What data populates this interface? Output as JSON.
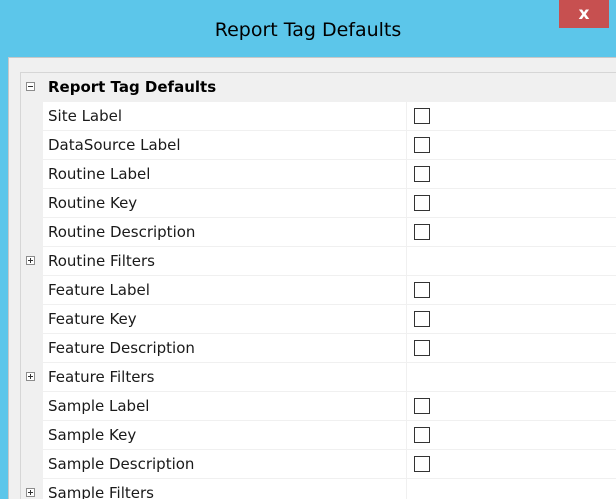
{
  "window": {
    "title": "Report Tag Defaults",
    "close_label": "x"
  },
  "grid": {
    "category": {
      "label": "Report Tag Defaults",
      "expanded": true,
      "expander_glyph": "minus"
    },
    "rows": [
      {
        "label": "Site Label",
        "kind": "checkbox",
        "checked": false
      },
      {
        "label": "DataSource Label",
        "kind": "checkbox",
        "checked": false
      },
      {
        "label": "Routine Label",
        "kind": "checkbox",
        "checked": false
      },
      {
        "label": "Routine Key",
        "kind": "checkbox",
        "checked": false
      },
      {
        "label": "Routine Description",
        "kind": "checkbox",
        "checked": false
      },
      {
        "label": "Routine Filters",
        "kind": "group",
        "expanded": false
      },
      {
        "label": "Feature Label",
        "kind": "checkbox",
        "checked": false
      },
      {
        "label": "Feature Key",
        "kind": "checkbox",
        "checked": false
      },
      {
        "label": "Feature Description",
        "kind": "checkbox",
        "checked": false
      },
      {
        "label": "Feature Filters",
        "kind": "group",
        "expanded": false
      },
      {
        "label": "Sample Label",
        "kind": "checkbox",
        "checked": false
      },
      {
        "label": "Sample Key",
        "kind": "checkbox",
        "checked": false
      },
      {
        "label": "Sample Description",
        "kind": "checkbox",
        "checked": false
      },
      {
        "label": "Sample Filters",
        "kind": "group",
        "expanded": false
      }
    ]
  },
  "colors": {
    "titlebar": "#5cc6ea",
    "close_button": "#c75050",
    "category_bg": "#f0f0f0"
  }
}
